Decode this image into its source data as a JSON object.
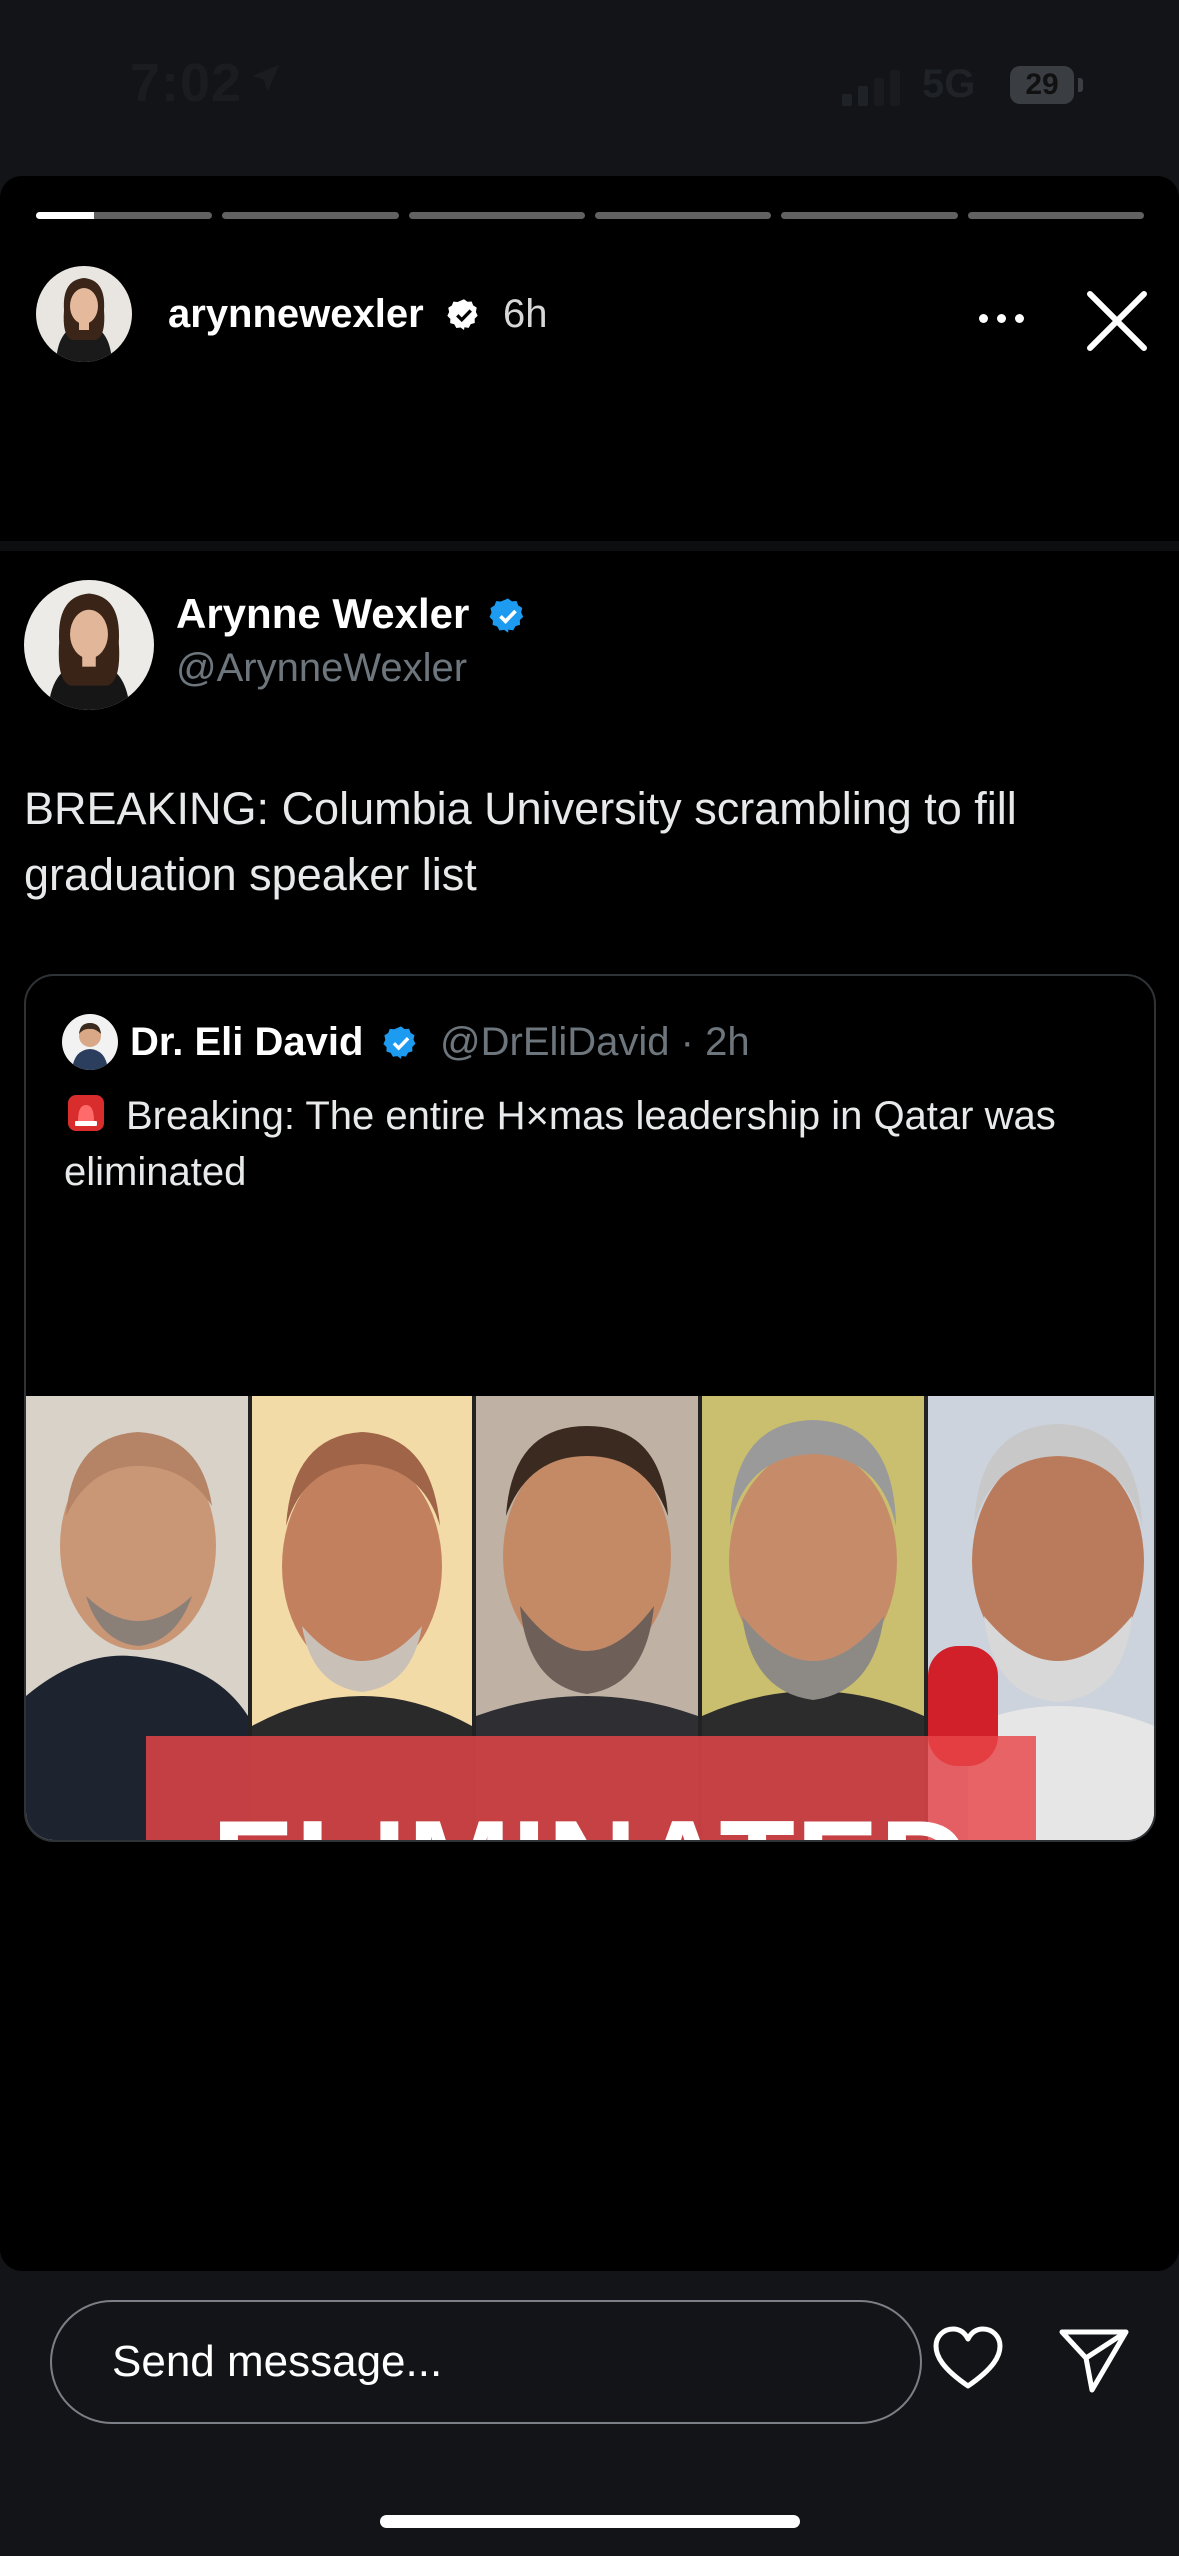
{
  "status_bar": {
    "time": "7:02",
    "network": "5G",
    "battery": "29",
    "icons": [
      "location-arrow-icon",
      "signal-icon",
      "battery-icon"
    ]
  },
  "story": {
    "segments": 6,
    "active_segment_progress": 0.33,
    "username": "arynnewexler",
    "time_ago": "6h",
    "icons": [
      "verified-badge-icon",
      "more-icon",
      "close-icon"
    ]
  },
  "tweet": {
    "name": "Arynne Wexler",
    "handle": "@ArynneWexler",
    "text": "BREAKING: Columbia University scrambling to fill graduation speaker list",
    "quote": {
      "name": "Dr. Eli David",
      "meta": "@DrEliDavid · 2h",
      "text": "Breaking: The entire H×mas leadership in Qatar was eliminated",
      "image_caption": "ELIMINATED"
    }
  },
  "reply": {
    "placeholder": "Send message..."
  },
  "colors": {
    "background": "#000000",
    "verified_blue": "#1d9bf0",
    "banner_red": "#e84648",
    "muted": "#6e767d"
  }
}
